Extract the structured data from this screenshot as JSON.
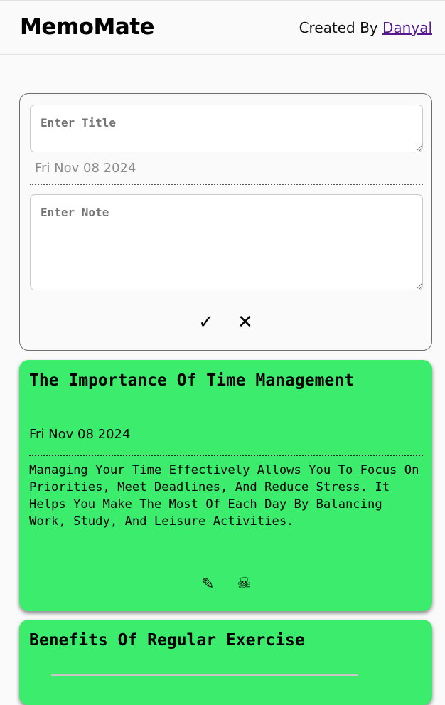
{
  "header": {
    "brand": "MemoMate",
    "credit_prefix": "Created By",
    "credit_link": "Danyal"
  },
  "form": {
    "title_placeholder": "Enter Title",
    "date": "Fri Nov 08 2024",
    "note_placeholder": "Enter Note",
    "confirm_icon": "✓",
    "cancel_icon": "✕"
  },
  "notes": [
    {
      "title": "The Importance Of Time Management",
      "date": "Fri Nov 08 2024",
      "body": "Managing Your Time Effectively Allows You To Focus On Priorities, Meet Deadlines, And Reduce Stress. It Helps You Make The Most Of Each Day By Balancing Work, Study, And Leisure Activities.",
      "edit_icon": "✏",
      "delete_icon": "☠",
      "color": "#3ced6d"
    },
    {
      "title": "Benefits Of Regular Exercise",
      "color": "#3ced6d"
    }
  ]
}
